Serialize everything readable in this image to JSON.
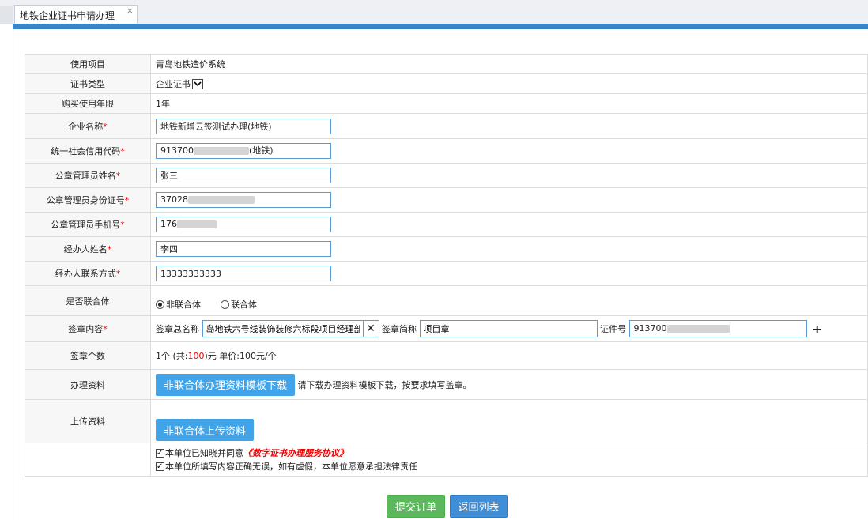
{
  "tab": {
    "title": "地铁企业证书申请办理",
    "close": "×"
  },
  "form": {
    "project": {
      "label": "使用项目",
      "value": "青岛地铁造价系统"
    },
    "cert_type": {
      "label": "证书类型",
      "value": "企业证书"
    },
    "years": {
      "label": "购买使用年限",
      "value": "1年"
    },
    "company": {
      "label": "企业名称",
      "value": "地铁新增云签测试办理(地铁)"
    },
    "credit_code": {
      "label": "统一社会信用代码",
      "value_prefix": "913700",
      "value_suffix": "(地铁)"
    },
    "admin_name": {
      "label": "公章管理员姓名",
      "value": "张三"
    },
    "admin_id": {
      "label": "公章管理员身份证号",
      "value_prefix": "37028"
    },
    "admin_phone": {
      "label": "公章管理员手机号",
      "value_prefix": "176"
    },
    "agent_name": {
      "label": "经办人姓名",
      "value": "李四"
    },
    "agent_contact": {
      "label": "经办人联系方式",
      "value": "13333333333"
    },
    "union": {
      "label": "是否联合体",
      "option_non": "非联合体",
      "option_union": "联合体"
    },
    "seal": {
      "label": "签章内容",
      "full_name_label": "签章总名称",
      "full_name_value": "岛地铁六号线装饰装修六标段项目经理部",
      "short_name_label": "签章简称",
      "short_name_value": "项目章",
      "cert_no_label": "证件号",
      "cert_no_prefix": "913700",
      "add": "+"
    },
    "seal_count": {
      "label": "签章个数",
      "text_1": "1个 (共:",
      "total": "100",
      "text_2": ")元 单价:100元/个"
    },
    "materials": {
      "label": "办理资料",
      "button": "非联合体办理资料模板下载",
      "hint": "请下载办理资料模板下载，按要求填写盖章。"
    },
    "upload": {
      "label": "上传资料",
      "button": "非联合体上传资料"
    },
    "agreement": {
      "line1": "本单位已知晓并同意",
      "link": "《数字证书办理服务协议》",
      "line2": "本单位所填写内容正确无误，如有虚假，本单位愿意承担法律责任"
    },
    "required_mark": "*"
  },
  "actions": {
    "submit": "提交订单",
    "back": "返回列表"
  },
  "colors": {
    "accent": "#3a85c8",
    "required": "#ee0000",
    "submit": "#5cb85c",
    "back": "#3f8ed6",
    "button": "#42a4e8"
  }
}
